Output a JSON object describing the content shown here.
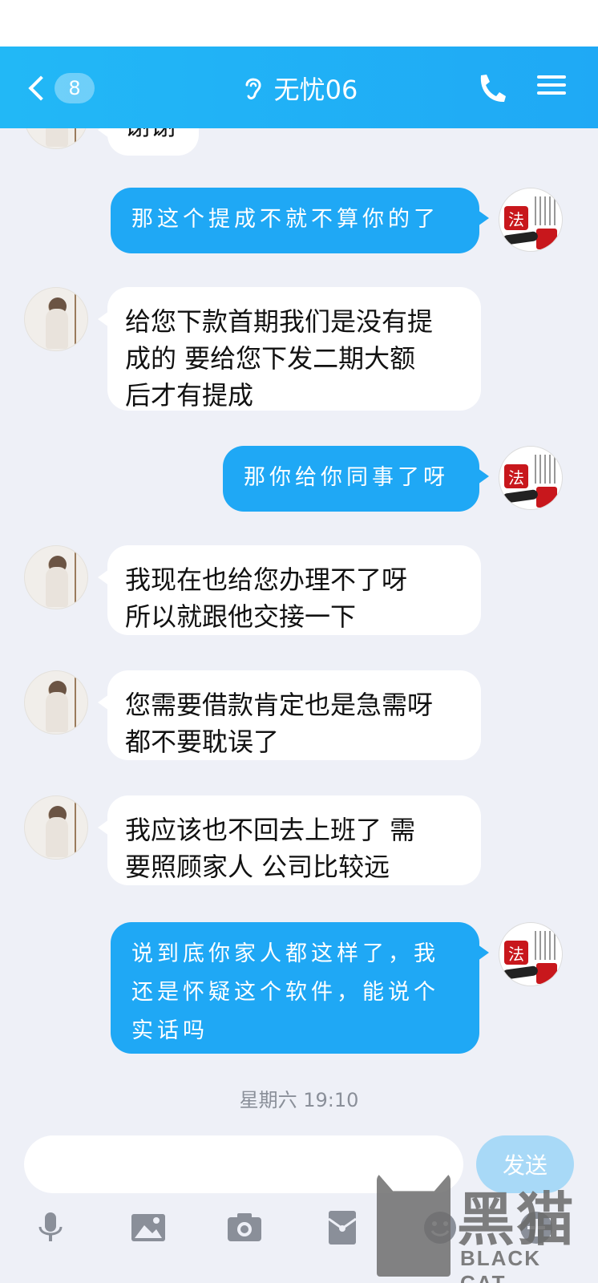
{
  "header": {
    "back_badge": "8",
    "title": "无忧06",
    "icons": [
      "back-chevron-icon",
      "ear-icon",
      "phone-icon",
      "menu-icon"
    ]
  },
  "messages": [
    {
      "side": "left",
      "text": "谢谢"
    },
    {
      "side": "right",
      "text": "那这个提成不就不算你的了"
    },
    {
      "side": "left",
      "text": "给您下款首期我们是没有提\n成的  要给您下发二期大额\n后才有提成"
    },
    {
      "side": "right",
      "text": "那你给你同事了呀"
    },
    {
      "side": "left",
      "text": "我现在也给您办理不了呀\n所以就跟他交接一下"
    },
    {
      "side": "left",
      "text": "您需要借款肯定也是急需呀\n都不要耽误了"
    },
    {
      "side": "left",
      "text": "我应该也不回去上班了  需\n要照顾家人  公司比较远"
    },
    {
      "side": "right",
      "text": "说到底你家人都这样了，我\n还是怀疑这个软件，能说个\n实话吗"
    }
  ],
  "timestamp": "星期六 19:10",
  "input": {
    "value": "",
    "placeholder": ""
  },
  "send_label": "发送",
  "toolbar_icons": [
    "microphone-icon",
    "image-icon",
    "camera-icon",
    "red-packet-icon",
    "emoji-icon",
    "more-icon"
  ],
  "watermark": {
    "title": "黑猫",
    "subtitle": "BLACK CAT"
  },
  "colors": {
    "accent": "#1fa8f5",
    "header": "#22b8f6",
    "background": "#eef0f7"
  }
}
